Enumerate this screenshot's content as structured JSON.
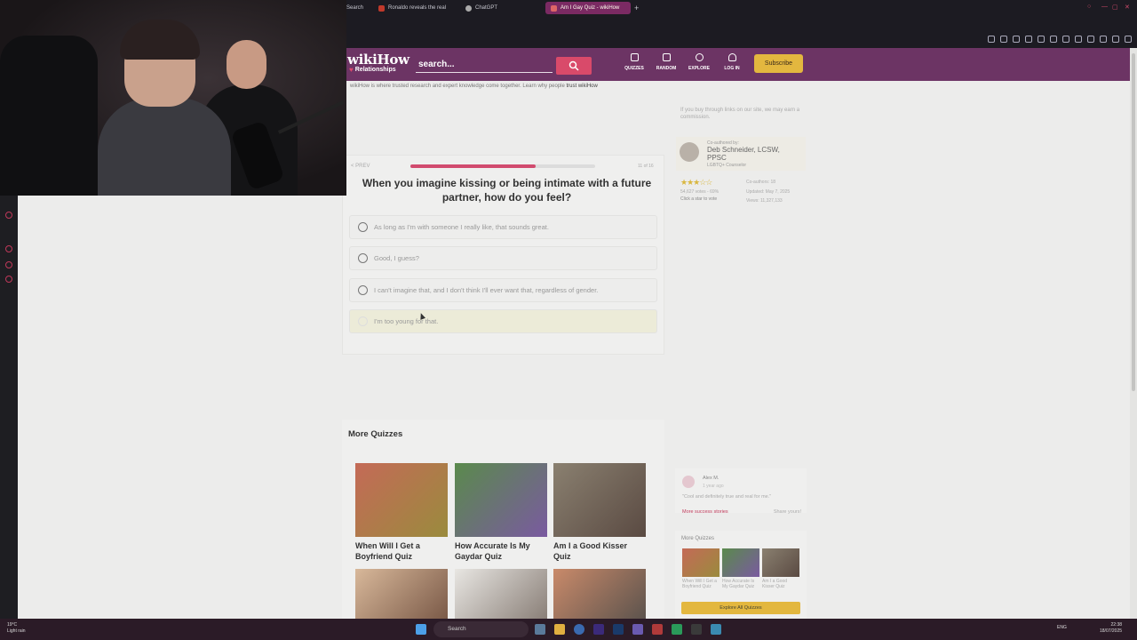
{
  "tabs": [
    {
      "label": "Search"
    },
    {
      "label": "Ronaldo reveals the real"
    },
    {
      "label": "ChatGPT"
    },
    {
      "label": "Am I Gay Quiz - wikiHow"
    }
  ],
  "header": {
    "logo": "wikiHow",
    "category": "Relationships",
    "search_placeholder": "search...",
    "nav": [
      {
        "label": "QUIZZES"
      },
      {
        "label": "RANDOM"
      },
      {
        "label": "EXPLORE"
      },
      {
        "label": "LOG IN"
      }
    ],
    "subscribe": "Subscribe"
  },
  "trust": {
    "text": "wikiHow is where trusted research and expert knowledge come together. Learn why people",
    "link": "trust wikiHow"
  },
  "quiz": {
    "back": "< PREV",
    "progress": 0.68,
    "count": "11 of 16",
    "question": "When you imagine kissing or being intimate with a future partner, how do you feel?",
    "options": [
      {
        "label": "As long as I'm with someone I really like, that sounds great."
      },
      {
        "label": "Good, I guess?"
      },
      {
        "label": "I can't imagine that, and I don't think I'll ever want that, regardless of gender."
      },
      {
        "label": "I'm too young for that."
      }
    ]
  },
  "sidebar": {
    "disclaimer": "If you buy through links on our site, we may earn a commission.",
    "coauthor_label": "Co-authored by:",
    "coauthor_name": "Deb Schneider, LCSW, PPSC",
    "coauthor_role": "LGBTQ+ Counselor",
    "rating_count": "54,627 votes - 69%",
    "rating_cta": "Click a star to vote",
    "co_authors": "Co-authors: 18",
    "updated": "Updated: May 7, 2025",
    "views": "Views: 11,327,133",
    "rating": 3.5
  },
  "more_quizzes": {
    "title": "More Quizzes",
    "items": [
      {
        "caption": "When Will I Get a Boyfriend Quiz",
        "color1": "#c46a57",
        "color2": "#9a8b3d"
      },
      {
        "caption": "How Accurate Is My Gaydar Quiz",
        "color1": "#5a8a4c",
        "color2": "#7a5aa0"
      },
      {
        "caption": "Am I a Good Kisser Quiz",
        "color1": "#8a8070",
        "color2": "#5a4a42"
      },
      {
        "caption": "",
        "color1": "#d8b89a",
        "color2": "#6b4a3a"
      },
      {
        "caption": "",
        "color1": "#e8e6e2",
        "color2": "#7a6e66"
      },
      {
        "caption": "",
        "color1": "#c98a6a",
        "color2": "#4a4a48"
      }
    ]
  },
  "success": {
    "name": "Alex M.",
    "ago": "1 year ago",
    "quote": "\"Cool and definitely true and real for me.\"",
    "more": "More success stories",
    "share": "Share yours!"
  },
  "right_more": {
    "title": "More Quizzes",
    "items": [
      {
        "caption": "When Will I Get a Boyfriend Quiz"
      },
      {
        "caption": "How Accurate Is My Gaydar Quiz"
      },
      {
        "caption": "Am I a Good Kisser Quiz"
      }
    ],
    "button": "Explore All Quizzes"
  },
  "taskbar": {
    "temp": "19°C",
    "weather": "Light rain",
    "search": "Search",
    "lang": "ENG",
    "time": "22:38",
    "date": "18/07/2025"
  },
  "colors": {
    "brand": "#6c3464",
    "accent": "#d94a6a",
    "gold": "#e3b73f"
  }
}
